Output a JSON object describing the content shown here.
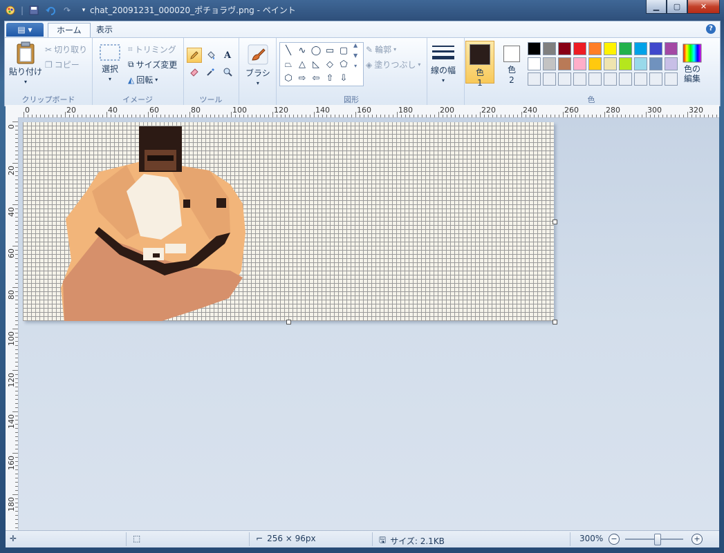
{
  "window": {
    "title": "chat_20091231_000020_ポチョラヴ.png - ペイント",
    "controls": [
      "minimize",
      "maximize",
      "close"
    ]
  },
  "ribbon": {
    "tabs": [
      {
        "label": "ホーム",
        "active": true
      },
      {
        "label": "表示",
        "active": false
      }
    ],
    "clipboard": {
      "label": "クリップボード",
      "paste": "貼り付け",
      "cut": "切り取り",
      "copy": "コピー"
    },
    "image": {
      "label": "イメージ",
      "select": "選択",
      "crop": "トリミング",
      "resize": "サイズ変更",
      "rotate": "回転"
    },
    "tools": {
      "label": "ツール",
      "items": [
        "pencil-icon",
        "fill-icon",
        "text-icon",
        "eraser-icon",
        "color-picker-icon",
        "magnifier-icon"
      ]
    },
    "brushes": {
      "label": "ブラシ"
    },
    "shapes": {
      "label": "図形",
      "outline": "輪郭",
      "fill": "塗りつぶし",
      "items": [
        "╲",
        "∿",
        "◯",
        "▭",
        "▢",
        "⏢",
        "△",
        "◺",
        "◇",
        "⬠",
        "⬡",
        "⇨",
        "⇦",
        "⇧",
        "⇩"
      ]
    },
    "line_width": {
      "label": "線の幅"
    },
    "colors": {
      "label": "色",
      "color1_label": "色",
      "color1_num": "1",
      "color1_value": "#2b1d1a",
      "color2_label": "色",
      "color2_num": "2",
      "color2_value": "#ffffff",
      "edit_colors": "色の\n編集",
      "palette": [
        "#000000",
        "#7f7f7f",
        "#880015",
        "#ed1c24",
        "#ff7f27",
        "#fff200",
        "#22b14c",
        "#00a2e8",
        "#3f48cc",
        "#a349a4",
        "#ffffff",
        "#c3c3c3",
        "#b97a57",
        "#ffaec9",
        "#ffc90e",
        "#efe4b0",
        "#b5e61d",
        "#99d9ea",
        "#7092be",
        "#c8bfe7",
        "#e9eef5",
        "#e9eef5",
        "#e9eef5",
        "#e9eef5",
        "#e9eef5",
        "#e9eef5",
        "#e9eef5",
        "#e9eef5",
        "#e9eef5",
        "#e9eef5"
      ]
    }
  },
  "rulers": {
    "top": [
      "0",
      "20",
      "40",
      "60",
      "80",
      "100",
      "120",
      "140",
      "160",
      "180",
      "200",
      "220",
      "240",
      "260",
      "280",
      "300",
      "320"
    ],
    "left": [
      "0",
      "20",
      "40",
      "60",
      "80",
      "100",
      "120",
      "140",
      "160",
      "180"
    ]
  },
  "status": {
    "image_size": "256 × 96px",
    "file_size": "サイズ: 2.1KB",
    "zoom": "300%",
    "zoom_level": 0.55
  }
}
